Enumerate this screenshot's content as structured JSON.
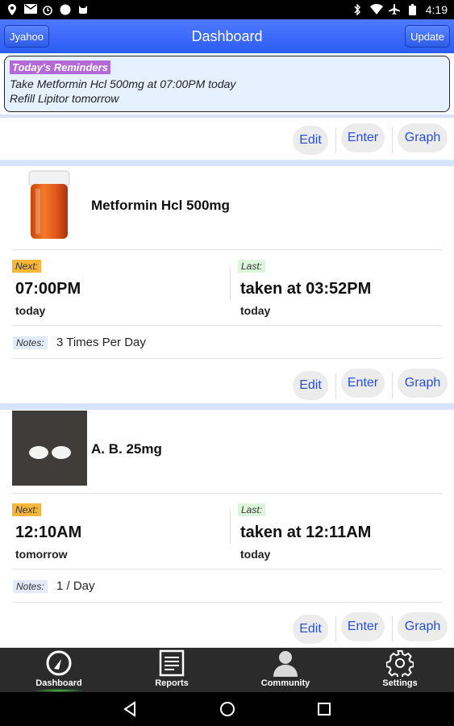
{
  "status_bar": {
    "time": "4:19",
    "left_icons": [
      "location-icon",
      "gmail-icon",
      "alarm-icon",
      "circle-icon",
      "cat-icon"
    ],
    "right_icons": [
      "bluetooth-icon",
      "wifi-icon",
      "airplane-icon",
      "battery-icon"
    ]
  },
  "header": {
    "left_button": "Jyahoo",
    "title": "Dashboard",
    "right_button": "Update"
  },
  "reminders": {
    "title": "Today's Reminders",
    "lines": [
      "Take Metformin Hcl 500mg at 07:00PM today",
      "Refill Lipitor tomorrow"
    ]
  },
  "actions": {
    "edit": "Edit",
    "enter": "Enter",
    "graph": "Graph"
  },
  "labels": {
    "next": "Next:",
    "last": "Last:",
    "notes": "Notes:"
  },
  "medications": [
    {
      "name": "Metformin Hcl 500mg",
      "image": "pill-bottle",
      "next_time": "07:00PM",
      "next_day": "today",
      "last_time": "taken at 03:52PM",
      "last_day": "today",
      "notes": "3 Times Per Day"
    },
    {
      "name": "A. B. 25mg",
      "image": "white-pills",
      "next_time": "12:10AM",
      "next_day": "tomorrow",
      "last_time": "taken at 12:11AM",
      "last_day": "today",
      "notes": "1 / Day"
    }
  ],
  "tabs": [
    {
      "label": "Dashboard",
      "icon": "gauge-icon",
      "active": true
    },
    {
      "label": "Reports",
      "icon": "report-icon",
      "active": false
    },
    {
      "label": "Community",
      "icon": "person-icon",
      "active": false
    },
    {
      "label": "Settings",
      "icon": "gear-icon",
      "active": false
    }
  ],
  "colors": {
    "header": "#2a5cf5",
    "reminder_bg": "#e6f1ff",
    "reminder_title_bg": "#b36ad8",
    "next_tag": "#f5b73a",
    "last_tag": "#dcf6dc",
    "action_text": "#2a4fd4",
    "active_tab_glow": "#3fc93f"
  }
}
